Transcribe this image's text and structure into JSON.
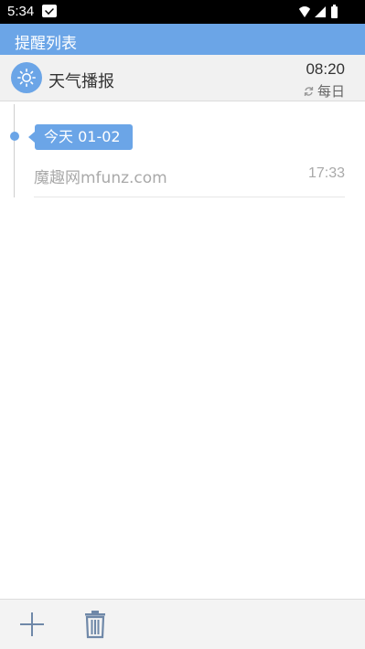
{
  "status_bar": {
    "time": "5:34"
  },
  "app_bar": {
    "title": "提醒列表"
  },
  "weather": {
    "label": "天气播报",
    "time": "08:20",
    "repeat": "每日",
    "icons": {
      "badge": "sun-icon",
      "repeat": "repeat-icon"
    }
  },
  "timeline": {
    "date_tag": "今天 01-02",
    "items": [
      {
        "text": "魔趣网mfunz.com",
        "time": "17:33"
      }
    ]
  },
  "bottom_bar": {
    "icons": {
      "add": "plus-icon",
      "delete": "trash-icon"
    }
  },
  "colors": {
    "accent": "#6ba5e7",
    "bottom_icon": "#6f88a8",
    "muted_text": "#a9a9a9"
  }
}
